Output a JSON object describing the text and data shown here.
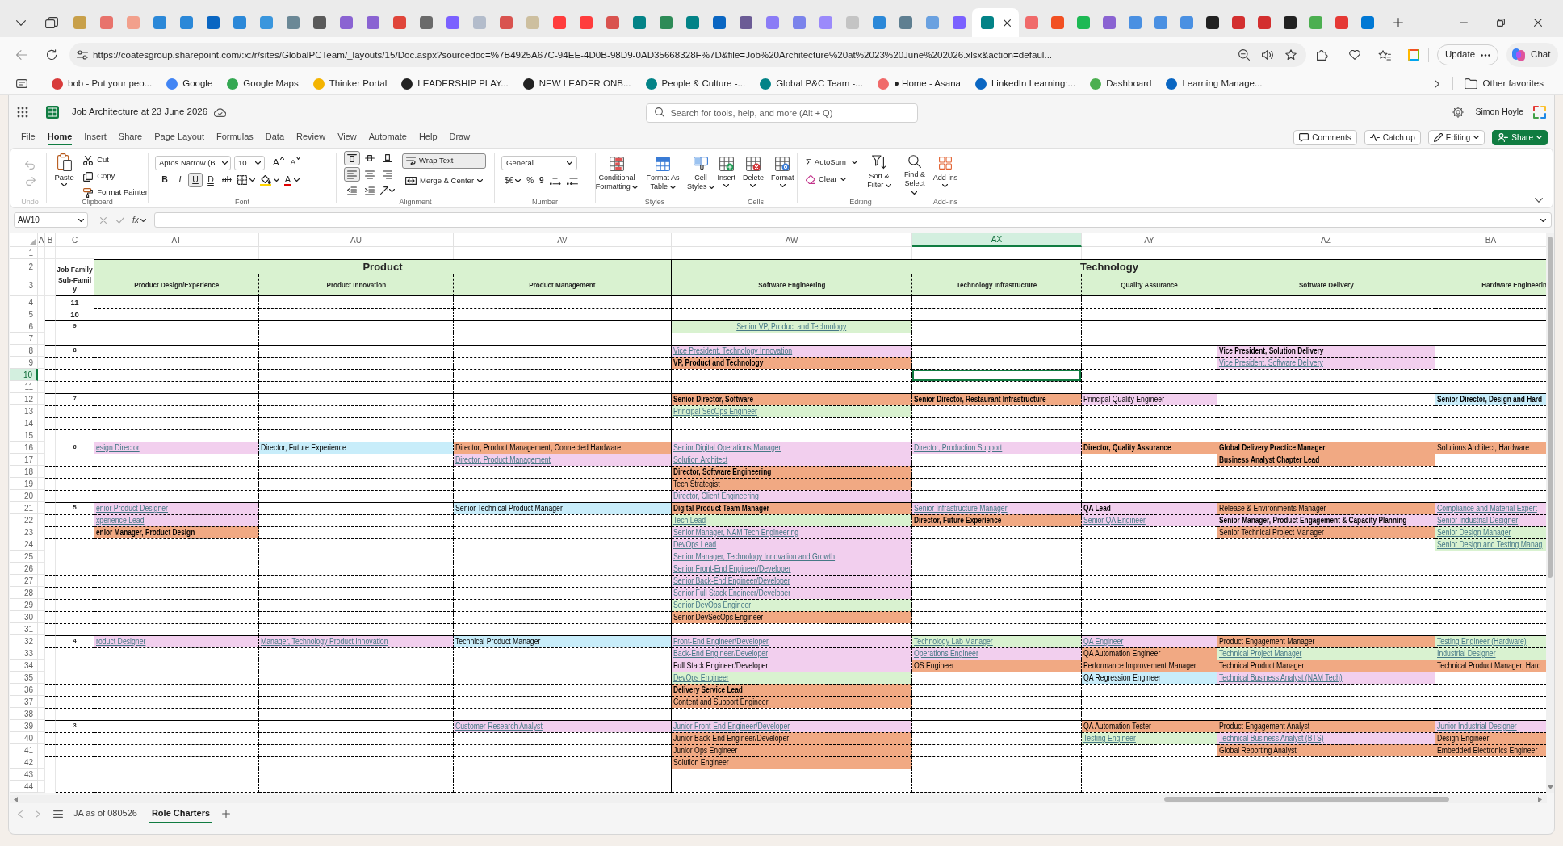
{
  "browser": {
    "tabs": [
      {
        "color": "#c8a04a",
        "selected": false
      },
      {
        "color": "#e8736c",
        "selected": false
      },
      {
        "color": "#f2a08c",
        "selected": false
      },
      {
        "color": "#2b88d8",
        "selected": false
      },
      {
        "color": "#2b88d8",
        "selected": false
      },
      {
        "color": "#0a66c2",
        "selected": false
      },
      {
        "color": "#2b88d8",
        "selected": false
      },
      {
        "color": "#3a96dd",
        "selected": false
      },
      {
        "color": "#6b8896",
        "selected": false
      },
      {
        "color": "#5a5a5a",
        "selected": false
      },
      {
        "color": "#8a63d2",
        "selected": false
      },
      {
        "color": "#8a63d2",
        "selected": false
      },
      {
        "color": "#e0453a",
        "selected": false
      },
      {
        "color": "#6a6a6a",
        "selected": false
      },
      {
        "color": "#7b61ff",
        "selected": false
      },
      {
        "color": "#b3bccb",
        "selected": false
      },
      {
        "color": "#d9534f",
        "selected": false
      },
      {
        "color": "#cdbf9f",
        "selected": false
      },
      {
        "color": "#ff3d3d",
        "selected": false
      },
      {
        "color": "#ff3d3d",
        "selected": false
      },
      {
        "color": "#d9534f",
        "selected": false
      },
      {
        "color": "#038387",
        "selected": false
      },
      {
        "color": "#2e8b57",
        "selected": false
      },
      {
        "color": "#038387",
        "selected": false
      },
      {
        "color": "#0a66c2",
        "selected": false
      },
      {
        "color": "#6b5b95",
        "selected": false
      },
      {
        "color": "#8b7cf6",
        "selected": false
      },
      {
        "color": "#7b83eb",
        "selected": false
      },
      {
        "color": "#9b8afb",
        "selected": false
      },
      {
        "color": "#c4c4c4",
        "selected": false
      },
      {
        "color": "#2b88d8",
        "selected": false
      },
      {
        "color": "#5f7f91",
        "selected": false
      },
      {
        "color": "#6aa1e0",
        "selected": false
      },
      {
        "color": "#7b61ff",
        "selected": false
      },
      {
        "color": "#038387",
        "selected": true
      },
      {
        "color": "#f06a6a",
        "selected": false
      },
      {
        "color": "#f25022",
        "selected": false
      },
      {
        "color": "#1db954",
        "selected": false
      },
      {
        "color": "#8a63d2",
        "selected": false
      },
      {
        "color": "#4a90e2",
        "selected": false
      },
      {
        "color": "#4a90e2",
        "selected": false
      },
      {
        "color": "#4a90e2",
        "selected": false
      },
      {
        "color": "#222222",
        "selected": false
      },
      {
        "color": "#d32f2f",
        "selected": false
      },
      {
        "color": "#d32f2f",
        "selected": false
      },
      {
        "color": "#222222",
        "selected": false
      },
      {
        "color": "#4caf50",
        "selected": false
      },
      {
        "color": "#e53935",
        "selected": false
      },
      {
        "color": "#0078d4",
        "selected": false
      }
    ],
    "address": "https://coatesgroup.sharepoint.com/:x:/r/sites/GlobalPCTeam/_layouts/15/Doc.aspx?sourcedoc=%7B4925A67C-94EE-4D0B-98D9-0AD35668328F%7D&file=Job%20Architecture%20at%2023%20June%202026.xlsx&action=defaul...",
    "update_button": "Update",
    "chat_button": "Chat",
    "bookmarks": [
      {
        "label": "bob - Put your peo...",
        "color": "#d83b3b"
      },
      {
        "label": "Google",
        "color": "#4285f4"
      },
      {
        "label": "Google Maps",
        "color": "#34a853"
      },
      {
        "label": "Thinker Portal",
        "color": "#f4b400"
      },
      {
        "label": "LEADERSHIP PLAY...",
        "color": "#222222"
      },
      {
        "label": "NEW LEADER ONB...",
        "color": "#222222"
      },
      {
        "label": "People & Culture -...",
        "color": "#038387"
      },
      {
        "label": "Global P&C Team -...",
        "color": "#038387"
      },
      {
        "label": "● Home - Asana",
        "color": "#f06a6a"
      },
      {
        "label": "LinkedIn Learning:...",
        "color": "#0a66c2"
      },
      {
        "label": "Dashboard",
        "color": "#4caf50"
      },
      {
        "label": "Learning Manage...",
        "color": "#0a66c2"
      }
    ],
    "other_favorites": "Other favorites"
  },
  "app": {
    "title": "Job Architecture at 23 June 2026",
    "search": {
      "placeholder": "Search for tools, help, and more (Alt + Q)"
    },
    "user": "Simon Hoyle",
    "menu": [
      {
        "label": "File",
        "selected": false
      },
      {
        "label": "Home",
        "selected": true
      },
      {
        "label": "Insert",
        "selected": false
      },
      {
        "label": "Share",
        "selected": false
      },
      {
        "label": "Page Layout",
        "selected": false
      },
      {
        "label": "Formulas",
        "selected": false
      },
      {
        "label": "Data",
        "selected": false
      },
      {
        "label": "Review",
        "selected": false
      },
      {
        "label": "View",
        "selected": false
      },
      {
        "label": "Automate",
        "selected": false
      },
      {
        "label": "Help",
        "selected": false
      },
      {
        "label": "Draw",
        "selected": false
      }
    ],
    "actions": [
      {
        "label": "Comments",
        "kind": "comments"
      },
      {
        "label": "Catch up",
        "kind": "catchup"
      },
      {
        "label": "Editing",
        "kind": "mode"
      },
      {
        "label": "Share",
        "kind": "primary"
      }
    ]
  },
  "ribbon": {
    "undo": {
      "label": "Undo",
      "disabled": true
    },
    "clipboard": {
      "label": "Clipboard",
      "paste": "Paste",
      "cut": "Cut",
      "copy": "Copy",
      "format_painter": "Format Painter"
    },
    "font": {
      "label": "Font",
      "family": "Aptos Narrow (B...",
      "size": "10",
      "grow": "A",
      "shrink": "A",
      "styles": [
        {
          "kind": "bold",
          "label": "B",
          "on": false
        },
        {
          "kind": "italic",
          "label": "I",
          "on": false
        },
        {
          "kind": "underline",
          "label": "U",
          "on": true
        },
        {
          "kind": "double",
          "label": "D",
          "on": false
        },
        {
          "kind": "strike",
          "label": "ab",
          "on": false
        }
      ],
      "color_button": "A"
    },
    "alignment": {
      "label": "Alignment",
      "vertical": [
        {
          "selected": true
        },
        {
          "selected": false
        },
        {
          "selected": false
        }
      ],
      "horizontal": [
        {
          "selected": true
        },
        {
          "selected": false
        },
        {
          "selected": false
        }
      ],
      "wrap_text": {
        "label": "Wrap Text",
        "on": true
      },
      "merge": "Merge & Center"
    },
    "number": {
      "label": "Number",
      "format": "General",
      "currency": "$€",
      "percent": "%",
      "comma": "9"
    },
    "styles": {
      "label": "Styles",
      "buttons": [
        {
          "kind": "conditional",
          "label": "Conditional Formatting"
        },
        {
          "kind": "table",
          "label": "Format As Table"
        },
        {
          "kind": "cellstyles",
          "label": "Cell Styles"
        }
      ]
    },
    "cells": {
      "label": "Cells",
      "buttons": [
        {
          "kind": "insert",
          "label": "Insert"
        },
        {
          "kind": "delete",
          "label": "Delete"
        },
        {
          "kind": "format",
          "label": "Format"
        }
      ]
    },
    "editing": {
      "label": "Editing",
      "sigma": "Σ",
      "autosum": "AutoSum",
      "clear": "Clear",
      "buttons": [
        {
          "kind": "sort",
          "label": "Sort & Filter"
        },
        {
          "kind": "find",
          "label": "Find & Select"
        }
      ]
    },
    "addins": {
      "label": "Add-ins",
      "button": "Add-ins"
    }
  },
  "formula_bar": {
    "name_box": "AW10",
    "fx": "fx"
  },
  "sheet": {
    "columns": [
      {
        "letter": "A",
        "selected": false
      },
      {
        "letter": "B",
        "selected": false
      },
      {
        "letter": "C",
        "selected": false
      },
      {
        "letter": "AT",
        "selected": false
      },
      {
        "letter": "AU",
        "selected": false
      },
      {
        "letter": "AV",
        "selected": false
      },
      {
        "letter": "AW",
        "selected": false
      },
      {
        "letter": "AX",
        "selected": true
      },
      {
        "letter": "AY",
        "selected": false
      },
      {
        "letter": "AZ",
        "selected": false
      },
      {
        "letter": "BA",
        "selected": false
      }
    ],
    "families": [
      {
        "name": "Product",
        "subfamilies": [
          "Product Design/Experience",
          "Product Innovation",
          "Product Management"
        ]
      },
      {
        "name": "Technology",
        "subfamilies": [
          "Software Engineering",
          "Technology Infrastructure",
          "Quality Assurance",
          "Software Delivery",
          "Hardware Engineerin"
        ]
      }
    ],
    "rows": [
      {
        "number": "1",
        "selected": false,
        "kind": "blank"
      },
      {
        "number": "2",
        "selected": false,
        "kind": "family",
        "label": "Job Family"
      },
      {
        "number": "3",
        "selected": false,
        "kind": "subfamily",
        "label": "Sub-Family"
      },
      {
        "number": "4",
        "selected": false,
        "kind": "body",
        "label": "11",
        "band_start": false
      },
      {
        "number": "5",
        "selected": false,
        "kind": "body",
        "label": "10",
        "band_start": false
      },
      {
        "number": "6",
        "selected": false,
        "kind": "body",
        "label": "9",
        "band_start": true,
        "cells": [
          null,
          null,
          null,
          {
            "text": "Senior VP, Product and Technology",
            "color": "#d9f2d0",
            "kind": "centered"
          }
        ]
      },
      {
        "number": "7",
        "selected": false,
        "kind": "body",
        "band_start": false
      },
      {
        "number": "8",
        "selected": false,
        "kind": "body",
        "label": "8",
        "band_start": true,
        "cells": [
          null,
          null,
          null,
          {
            "text": "Vice President, Technology Innovation",
            "color": "#f2cfee",
            "kind": "link"
          },
          null,
          null,
          {
            "text": "Vice President, Solution Delivery",
            "color": "#f2cfee",
            "kind": "bold"
          }
        ]
      },
      {
        "number": "9",
        "selected": false,
        "kind": "body",
        "band_start": false,
        "cells": [
          null,
          null,
          null,
          {
            "text": "VP, Product and Technology",
            "color": "#f1a983",
            "kind": "bold"
          },
          null,
          null,
          {
            "text": "Vice President, Software Delivery",
            "color": "#f2cfee",
            "kind": "link"
          }
        ]
      },
      {
        "number": "10",
        "selected": true,
        "kind": "body",
        "band_start": false
      },
      {
        "number": "11",
        "selected": false,
        "kind": "body",
        "band_start": false
      },
      {
        "number": "12",
        "selected": false,
        "kind": "body",
        "label": "7",
        "band_start": true,
        "cells": [
          null,
          null,
          null,
          {
            "text": "Senior Director, Software",
            "color": "#f1a983",
            "kind": "bold"
          },
          {
            "text": "Senior Director, Restaurant Infrastructure",
            "color": "#f1a983",
            "kind": "bold"
          },
          {
            "text": "Principal Quality Engineer",
            "color": "#f2cfee",
            "kind": "plain"
          },
          null,
          {
            "text": "Senior Director, Design and Hard",
            "color": "#c8edfa",
            "kind": "bold"
          }
        ]
      },
      {
        "number": "13",
        "selected": false,
        "kind": "body",
        "band_start": false,
        "cells": [
          null,
          null,
          null,
          {
            "text": "Principal SecOps Engineer",
            "color": "#d9f2d0",
            "kind": "link"
          }
        ]
      },
      {
        "number": "14",
        "selected": false,
        "kind": "body",
        "band_start": false
      },
      {
        "number": "15",
        "selected": false,
        "kind": "body",
        "band_start": false
      },
      {
        "number": "16",
        "selected": false,
        "kind": "body",
        "label": "6",
        "band_start": true,
        "cells": [
          {
            "text": "esign Director",
            "color": "#f2cfee",
            "kind": "link"
          },
          {
            "text": "Director, Future Experience",
            "color": "#c8edfa",
            "kind": "plain"
          },
          {
            "text": "Director, Product Management, Connected Hardware",
            "color": "#f1a983",
            "kind": "plain"
          },
          {
            "text": "Senior Digital Operations Manager",
            "color": "#f2cfee",
            "kind": "link"
          },
          {
            "text": "Director, Production Support",
            "color": "#f2cfee",
            "kind": "link"
          },
          {
            "text": "Director, Quality Assurance",
            "color": "#f1a983",
            "kind": "bold"
          },
          {
            "text": "Global Delivery Practice Manager",
            "color": "#f1a983",
            "kind": "bold"
          },
          {
            "text": "Solutions Architect, Hardware",
            "color": "#f1a983",
            "kind": "plain"
          }
        ]
      },
      {
        "number": "17",
        "selected": false,
        "kind": "body",
        "band_start": false,
        "cells": [
          null,
          null,
          {
            "text": "Director, Product Management",
            "color": "#f2cfee",
            "kind": "link"
          },
          {
            "text": "Solution Architect",
            "color": "#f2cfee",
            "kind": "link"
          },
          null,
          null,
          {
            "text": "Business Analyst Chapter Lead",
            "color": "#f1a983",
            "kind": "bold"
          }
        ]
      },
      {
        "number": "18",
        "selected": false,
        "kind": "body",
        "band_start": false,
        "cells": [
          null,
          null,
          null,
          {
            "text": "Director, Software Engineering",
            "color": "#f1a983",
            "kind": "bold"
          }
        ]
      },
      {
        "number": "19",
        "selected": false,
        "kind": "body",
        "band_start": false,
        "cells": [
          null,
          null,
          null,
          {
            "text": "Tech Strategist",
            "color": "#f1a983",
            "kind": "plain"
          }
        ]
      },
      {
        "number": "20",
        "selected": false,
        "kind": "body",
        "band_start": false,
        "cells": [
          null,
          null,
          null,
          {
            "text": "Director, Client Engineering",
            "color": "#f2cfee",
            "kind": "link"
          }
        ]
      },
      {
        "number": "21",
        "selected": false,
        "kind": "body",
        "label": "5",
        "band_start": true,
        "cells": [
          {
            "text": "enior Product Designer",
            "color": "#f2cfee",
            "kind": "link"
          },
          null,
          {
            "text": "Senior Technical Product Manager",
            "color": "#c8edfa",
            "kind": "plain"
          },
          {
            "text": "Digital Product Team Manager",
            "color": "#f1a983",
            "kind": "bold"
          },
          {
            "text": "Senior Infrastructure Manager",
            "color": "#f2cfee",
            "kind": "link"
          },
          {
            "text": "QA Lead",
            "color": "#f2cfee",
            "kind": "bold"
          },
          {
            "text": "Release & Environments Manager",
            "color": "#f1a983",
            "kind": "plain"
          },
          {
            "text": "Compliance and Material Expert",
            "color": "#f2cfee",
            "kind": "link"
          }
        ]
      },
      {
        "number": "22",
        "selected": false,
        "kind": "body",
        "band_start": false,
        "cells": [
          {
            "text": "xperience Lead",
            "color": "#f2cfee",
            "kind": "link"
          },
          null,
          null,
          {
            "text": "Tech Lead",
            "color": "#d9f2d0",
            "kind": "link"
          },
          {
            "text": "Director, Future Experience",
            "color": "#f1a983",
            "kind": "bold"
          },
          {
            "text": "Senior QA Engineer",
            "color": "#f2cfee",
            "kind": "link"
          },
          {
            "text": "Senior Manager, Product Engagement & Capacity Planning",
            "color": "#f2cfee",
            "kind": "bold"
          },
          {
            "text": "Senior Industrial Designer",
            "color": "#f2cfee",
            "kind": "link"
          }
        ]
      },
      {
        "number": "23",
        "selected": false,
        "kind": "body",
        "band_start": false,
        "cells": [
          {
            "text": "enior Manager, Product Design",
            "color": "#f1a983",
            "kind": "bold"
          },
          null,
          null,
          {
            "text": "Senior Manager, NAM Tech Engineering",
            "color": "#f2cfee",
            "kind": "link"
          },
          null,
          null,
          {
            "text": "Senior Technical Project Manager",
            "color": "#f1a983",
            "kind": "plain"
          },
          {
            "text": "Senior Design Manager",
            "color": "#d9f2d0",
            "kind": "link"
          }
        ]
      },
      {
        "number": "24",
        "selected": false,
        "kind": "body",
        "band_start": false,
        "cells": [
          null,
          null,
          null,
          {
            "text": "DevOps Lead",
            "color": "#f2cfee",
            "kind": "link"
          },
          null,
          null,
          null,
          {
            "text": "Senior Design and Testing Manag",
            "color": "#d9f2d0",
            "kind": "link"
          }
        ]
      },
      {
        "number": "25",
        "selected": false,
        "kind": "body",
        "band_start": false,
        "cells": [
          null,
          null,
          null,
          {
            "text": "Senior Manager, Technology Innovation and Growth",
            "color": "#f2cfee",
            "kind": "link"
          }
        ]
      },
      {
        "number": "26",
        "selected": false,
        "kind": "body",
        "band_start": false,
        "cells": [
          null,
          null,
          null,
          {
            "text": "Senior Front-End Engineer/Developer",
            "color": "#f2cfee",
            "kind": "link"
          }
        ]
      },
      {
        "number": "27",
        "selected": false,
        "kind": "body",
        "band_start": false,
        "cells": [
          null,
          null,
          null,
          {
            "text": "Senior Back-End Engineer/Developer",
            "color": "#f2cfee",
            "kind": "link"
          }
        ]
      },
      {
        "number": "28",
        "selected": false,
        "kind": "body",
        "band_start": false,
        "cells": [
          null,
          null,
          null,
          {
            "text": "Senior Full Stack Engineer/Developer",
            "color": "#f2cfee",
            "kind": "link"
          }
        ]
      },
      {
        "number": "29",
        "selected": false,
        "kind": "body",
        "band_start": false,
        "cells": [
          null,
          null,
          null,
          {
            "text": "Senior DevOps Engineer",
            "color": "#d9f2d0",
            "kind": "link"
          }
        ]
      },
      {
        "number": "30",
        "selected": false,
        "kind": "body",
        "band_start": false,
        "cells": [
          null,
          null,
          null,
          {
            "text": "Senior DevSecOps Engineer",
            "color": "#f1a983",
            "kind": "plain"
          }
        ]
      },
      {
        "number": "31",
        "selected": false,
        "kind": "body",
        "band_start": false
      },
      {
        "number": "32",
        "selected": false,
        "kind": "body",
        "label": "4",
        "band_start": true,
        "cells": [
          {
            "text": "roduct Designer",
            "color": "#f2cfee",
            "kind": "link"
          },
          {
            "text": "Manager, Technology Product Innovation",
            "color": "#f2cfee",
            "kind": "link"
          },
          {
            "text": "Technical Product Manager",
            "color": "#c8edfa",
            "kind": "plain"
          },
          {
            "text": "Front-End Engineer/Developer",
            "color": "#f2cfee",
            "kind": "link"
          },
          {
            "text": "Technology Lab Manager",
            "color": "#d9f2d0",
            "kind": "link"
          },
          {
            "text": "QA Engineer",
            "color": "#f2cfee",
            "kind": "link"
          },
          {
            "text": "Product Engagement Manager",
            "color": "#f1a983",
            "kind": "plain"
          },
          {
            "text": "Testing Engineer (Hardware)",
            "color": "#d9f2d0",
            "kind": "link"
          }
        ]
      },
      {
        "number": "33",
        "selected": false,
        "kind": "body",
        "band_start": false,
        "cells": [
          null,
          null,
          null,
          {
            "text": "Back-End Engineer/Developer",
            "color": "#f2cfee",
            "kind": "link"
          },
          {
            "text": "Operations Engineer",
            "color": "#f2cfee",
            "kind": "link"
          },
          {
            "text": "QA Automation Engineer",
            "color": "#f1a983",
            "kind": "plain"
          },
          {
            "text": "Technical Project Manager",
            "color": "#d9f2d0",
            "kind": "link"
          },
          {
            "text": "Industrial Designer",
            "color": "#d9f2d0",
            "kind": "link"
          }
        ]
      },
      {
        "number": "34",
        "selected": false,
        "kind": "body",
        "band_start": false,
        "cells": [
          null,
          null,
          null,
          {
            "text": "Full Stack Engineer/Developer",
            "color": "#f2cfee",
            "kind": "plain"
          },
          {
            "text": "OS Engineer",
            "color": "#f1a983",
            "kind": "plain"
          },
          {
            "text": "Performance Improvement Manager",
            "color": "#f1a983",
            "kind": "plain"
          },
          {
            "text": "Technical Product Manager",
            "color": "#f1a983",
            "kind": "plain"
          },
          {
            "text": "Technical Product Manager, Hard",
            "color": "#f1a983",
            "kind": "plain"
          }
        ]
      },
      {
        "number": "35",
        "selected": false,
        "kind": "body",
        "band_start": false,
        "cells": [
          null,
          null,
          null,
          {
            "text": "DevOps Engineer",
            "color": "#d9f2d0",
            "kind": "link"
          },
          null,
          {
            "text": "QA Regression Engineer",
            "color": "#c8edfa",
            "kind": "plain"
          },
          {
            "text": "Technical Business Analyst (NAM Tech)",
            "color": "#f2cfee",
            "kind": "link"
          }
        ]
      },
      {
        "number": "36",
        "selected": false,
        "kind": "body",
        "band_start": false,
        "cells": [
          null,
          null,
          null,
          {
            "text": "Delivery Service Lead",
            "color": "#f1a983",
            "kind": "bold"
          }
        ]
      },
      {
        "number": "37",
        "selected": false,
        "kind": "body",
        "band_start": false,
        "cells": [
          null,
          null,
          null,
          {
            "text": "Content and Support Engineer",
            "color": "#f1a983",
            "kind": "plain"
          }
        ]
      },
      {
        "number": "38",
        "selected": false,
        "kind": "body",
        "band_start": false
      },
      {
        "number": "39",
        "selected": false,
        "kind": "body",
        "label": "3",
        "band_start": true,
        "cells": [
          null,
          null,
          {
            "text": "Customer Research Analyst",
            "color": "#f2cfee",
            "kind": "link"
          },
          {
            "text": "Junior Front-End Engineer/Developer",
            "color": "#f2cfee",
            "kind": "link"
          },
          null,
          {
            "text": "QA Automation Tester",
            "color": "#f1a983",
            "kind": "plain"
          },
          {
            "text": "Product Engagement Analyst",
            "color": "#f1a983",
            "kind": "plain"
          },
          {
            "text": "Junior Industrial Designer",
            "color": "#f2cfee",
            "kind": "link"
          }
        ]
      },
      {
        "number": "40",
        "selected": false,
        "kind": "body",
        "band_start": false,
        "cells": [
          null,
          null,
          null,
          {
            "text": "Junior Back-End Engineer/Developer",
            "color": "#f1a983",
            "kind": "plain"
          },
          null,
          {
            "text": "Testing Engineer",
            "color": "#d9f2d0",
            "kind": "link"
          },
          {
            "text": "Technical Business Analyst (BTS)",
            "color": "#f2cfee",
            "kind": "link"
          },
          {
            "text": "Design Engineer",
            "color": "#f1a983",
            "kind": "plain"
          }
        ]
      },
      {
        "number": "41",
        "selected": false,
        "kind": "body",
        "band_start": false,
        "cells": [
          null,
          null,
          null,
          {
            "text": "Junior Ops Engineer",
            "color": "#f1a983",
            "kind": "plain"
          },
          null,
          null,
          {
            "text": "Global Reporting Analyst",
            "color": "#f1a983",
            "kind": "plain"
          },
          {
            "text": "Embedded Electronics Engineer",
            "color": "#f1a983",
            "kind": "plain"
          }
        ]
      },
      {
        "number": "42",
        "selected": false,
        "kind": "body",
        "band_start": false,
        "cells": [
          null,
          null,
          null,
          {
            "text": "Solution Engineer",
            "color": "#f1a983",
            "kind": "plain"
          }
        ]
      },
      {
        "number": "43",
        "selected": false,
        "kind": "body",
        "band_start": false
      },
      {
        "number": "44",
        "selected": false,
        "kind": "body",
        "band_start": false
      }
    ],
    "sheet_tabs": [
      {
        "label": "JA as of 080526",
        "selected": false
      },
      {
        "label": "Role Charters",
        "selected": true
      }
    ]
  }
}
